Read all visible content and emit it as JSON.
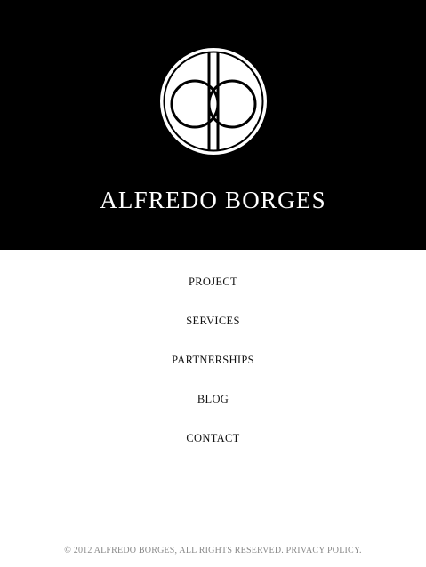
{
  "header": {
    "logo_letters": "ab",
    "brand_name": "ALFREDO BORGES",
    "background_color": "#000000"
  },
  "nav": {
    "items": [
      {
        "label": "PROJECT"
      },
      {
        "label": "SERVICES"
      },
      {
        "label": "PARTNERSHIPS"
      },
      {
        "label": "BLOG"
      },
      {
        "label": "CONTACT"
      }
    ]
  },
  "footer": {
    "copyright": "© 2012 ALFREDO BORGES, ALL RIGHTS RESERVED.",
    "privacy_link": "PRIVACY POLICY."
  }
}
